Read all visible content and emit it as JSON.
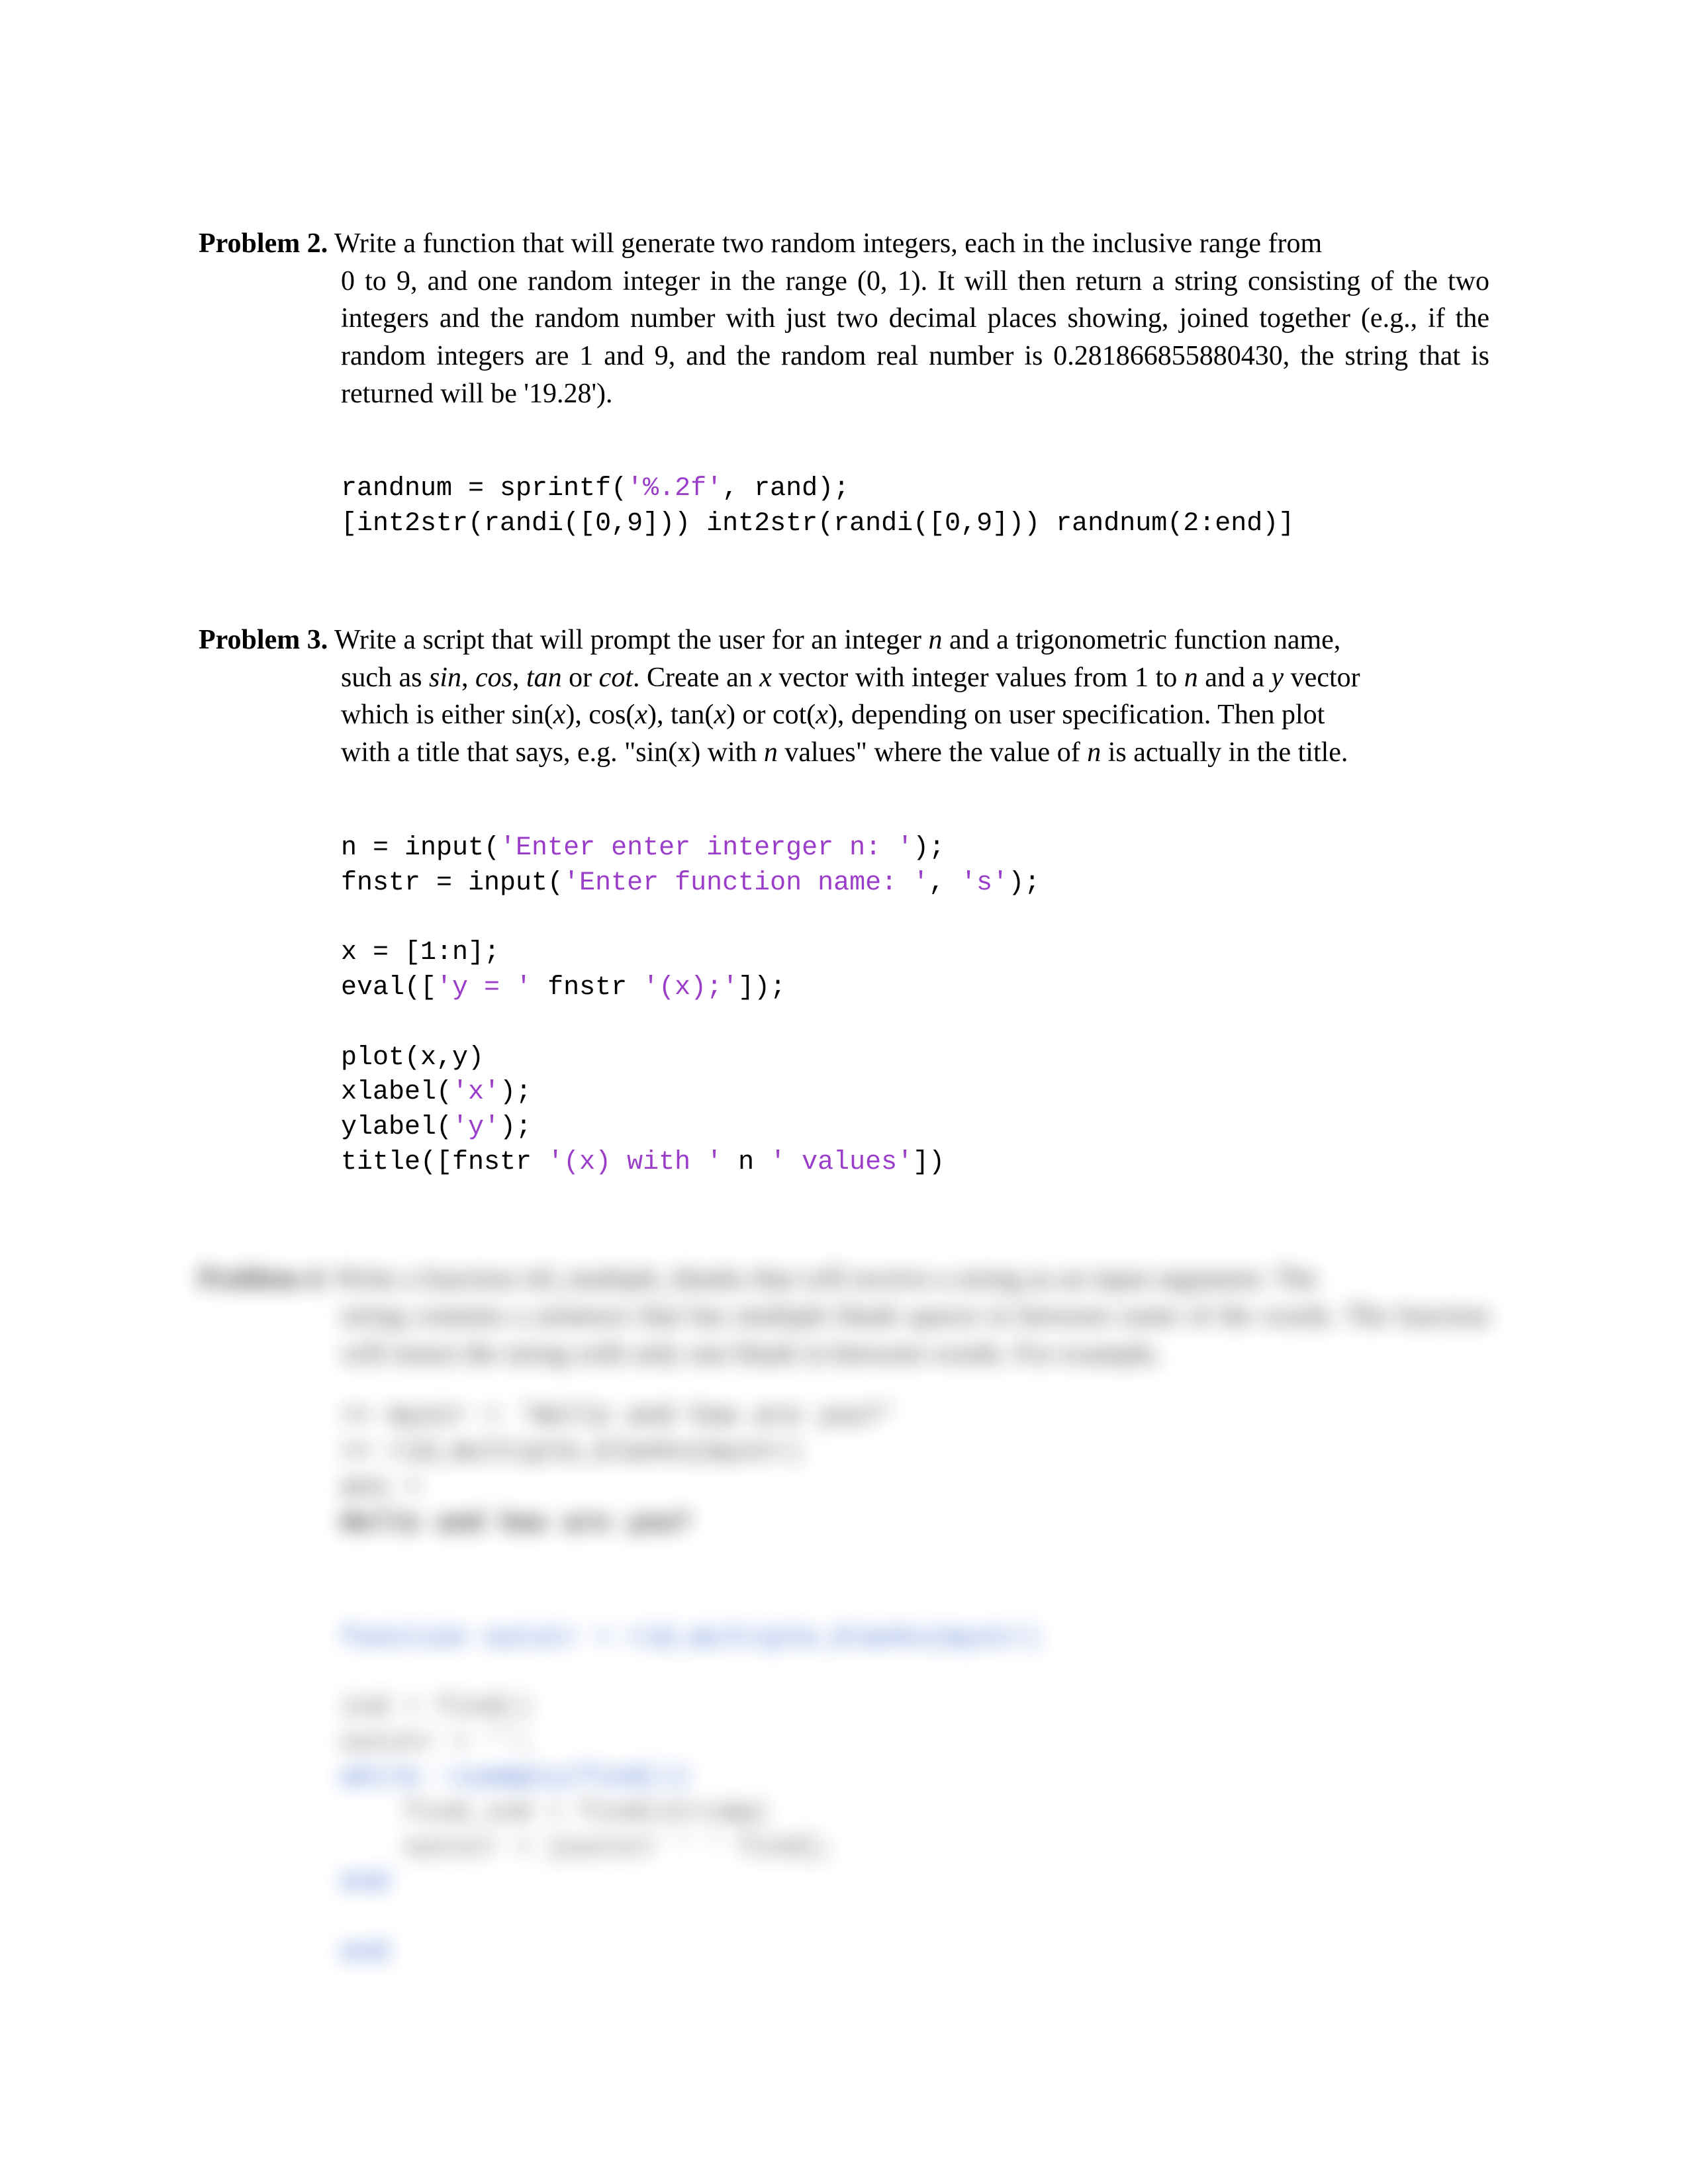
{
  "problem2": {
    "label": "Problem 2.",
    "text_line1": " Write a function that will generate two random integers, each in the inclusive range from",
    "text_rest": "0 to 9, and one random integer in the range (0, 1). It will then return a string consisting of the two integers and the random number with just two decimal places showing, joined together (e.g., if the random integers are 1 and 9, and the random real number is 0.281866855880430, the string that is returned will be '19.28').",
    "code": {
      "l1a": "randnum = sprintf(",
      "l1s": "'%.2f'",
      "l1b": ", rand);",
      "l2": "[int2str(randi([0,9])) int2str(randi([0,9])) randnum(2:end)]"
    }
  },
  "problem3": {
    "label": "Problem 3.",
    "text_l1a": " Write a script that will prompt the user for an integer ",
    "text_l1_n": "n",
    "text_l1b": " and a trigonometric function name,",
    "text_l2a": "such as ",
    "w_sin": "sin",
    "w_cos": "cos",
    "w_tan": "tan",
    "w_cot": "cot",
    "text_l2b": ". Create an ",
    "w_x": "x",
    "text_l2c": " vector with integer values from 1 to ",
    "w_n2": "n",
    "text_l2d": " and a ",
    "w_y": "y",
    "text_l2e": " vector",
    "text_l3a": "which is either sin(",
    "w_x1": "x",
    "text_l3b": "), cos(",
    "w_x2": "x",
    "text_l3c": "), tan(",
    "w_x3": "x",
    "text_l3d": ") or cot(",
    "w_x4": "x",
    "text_l3e": "), depending on user specification. Then plot",
    "text_l4a": "with a title that says, e.g. \"sin(x) with ",
    "w_n3": "n",
    "text_l4b": " values\" where the value of ",
    "w_n4": "n",
    "text_l4c": " is actually in the title.",
    "code": {
      "l1a": "n = input(",
      "l1s": "'Enter enter interger n: '",
      "l1b": ");",
      "l2a": "fnstr = input(",
      "l2s1": "'Enter function name: '",
      "l2m": ", ",
      "l2s2": "'s'",
      "l2b": ");",
      "l3": "x = [1:n];",
      "l4a": "eval([",
      "l4s1": "'y = '",
      "l4m": " fnstr ",
      "l4s2": "'(x);'",
      "l4b": "]);",
      "l5": "plot(x,y)",
      "l6a": "xlabel(",
      "l6s": "'x'",
      "l6b": ");",
      "l7a": "ylabel(",
      "l7s": "'y'",
      "l7b": ");",
      "l8a": "title([fnstr ",
      "l8s1": "'(x) with '",
      "l8m": " n ",
      "l8s2": "' values'",
      "l8b": "])"
    }
  },
  "problem4_blurred": {
    "label": "Problem 4.",
    "text_line1": " Write a function rid_multiple_blanks that will receive a string as an input argument. The",
    "text_rest": "string contains a sentence that has multiple blank spaces in between some of the words. The function will return the string with only one blank in between words. For example,",
    "example": {
      "l1": ">> mystr = 'Hello  and   how are   you?'",
      "l2": ">> rid_multiple_blanks(mystr)",
      "l3": "ans =",
      "l4": "    Hello and how are you?"
    },
    "code": {
      "l1": "function outstr = rid_multiple_blanks(mystr)",
      "l2": "ind = find()",
      "l3": "outstr = '';",
      "l4": "while ~isempty(find())",
      "l5": "    find_ind = find(strcmp(",
      "l6": "    outstr = [outstr ' ' find];",
      "l7": "end",
      "l8": "end"
    }
  }
}
